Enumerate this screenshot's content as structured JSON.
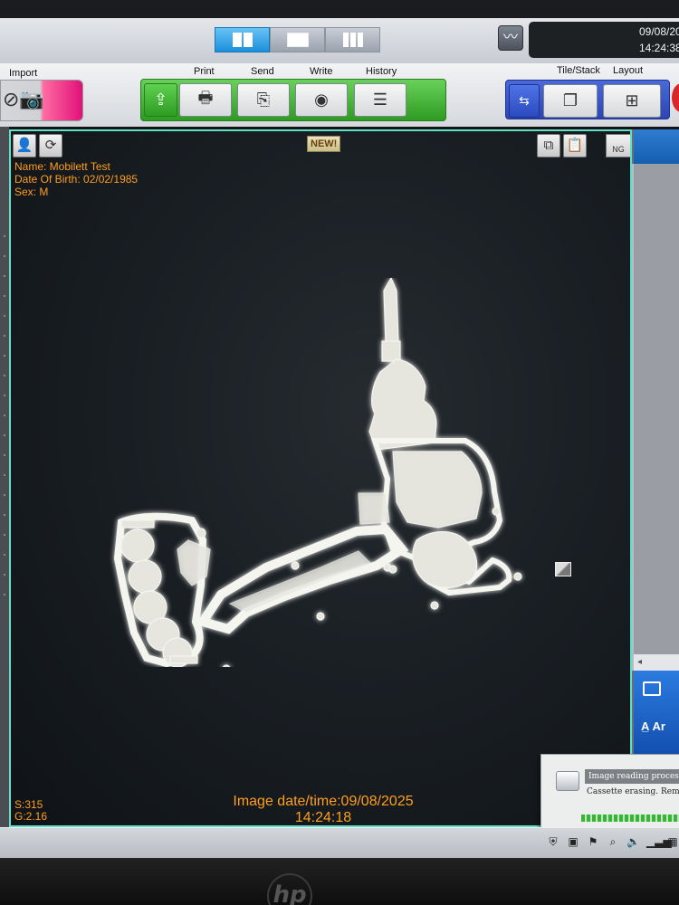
{
  "clock": {
    "date": "09/08/20",
    "time": "14:24:38"
  },
  "toolbar": {
    "import_label": "Import",
    "print_label": "Print",
    "send_label": "Send",
    "write_label": "Write",
    "history_label": "History",
    "tile_stack_label": "Tile/Stack",
    "layout_label": "Layout"
  },
  "viewer": {
    "new_badge": "NEW!",
    "ng_label": "NG",
    "patient_name": "Name: Mobilett Test",
    "patient_dob": "Date Of Birth: 02/02/1985",
    "patient_sex": "Sex: M",
    "image_datetime_line1": "Image date/time:09/08/2025",
    "image_datetime_line2": "14:24:18",
    "s_value": "S:315",
    "g_value": "G:2.16"
  },
  "right_panel": {
    "label": "A̲ Ar"
  },
  "popup": {
    "title": "Image reading process",
    "subtitle": "Cassette erasing. Remaini"
  },
  "colors": {
    "overlay_text": "#ff9f1a",
    "viewer_border": "#5fe0c8",
    "print_group": "#3aa52c",
    "layout_group": "#2c45b2",
    "import_accent": "#e0117a"
  },
  "icons": [
    "user-icon",
    "rotate-user-icon",
    "copy-icon",
    "clipboard-icon",
    "camera-icon",
    "upload-icon",
    "printer-icon",
    "send-icon",
    "disc-icon",
    "list-icon",
    "tile-icon",
    "stack-icon",
    "grid-icon",
    "graph-icon",
    "scanner-icon"
  ]
}
